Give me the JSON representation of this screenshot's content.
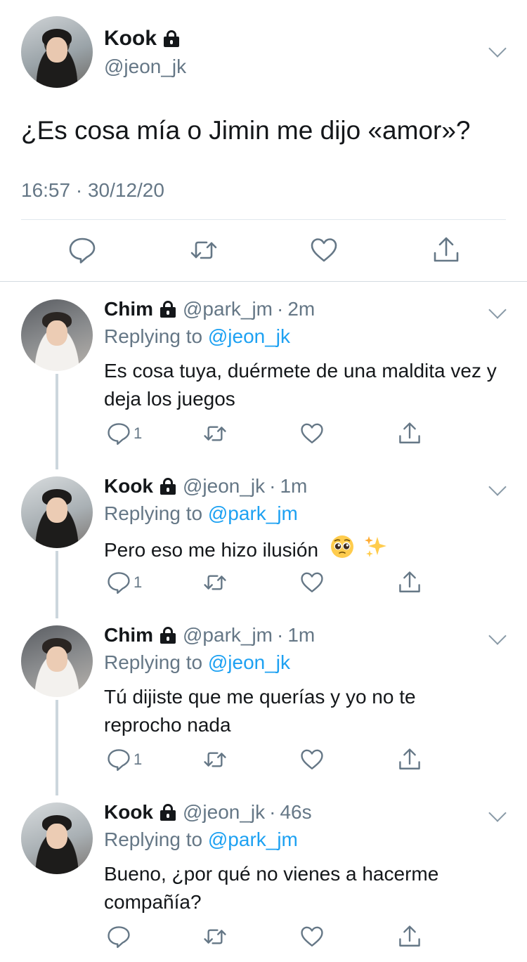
{
  "main_tweet": {
    "display_name": "Kook",
    "handle": "@jeon_jk",
    "text": "¿Es cosa mía o Jimin me dijo «amor»?",
    "timestamp": "16:57 · 30/12/20",
    "actions": [
      "reply-icon",
      "retweet-icon",
      "like-icon",
      "share-icon"
    ]
  },
  "replies": [
    {
      "display_name": "Chim",
      "handle": "@park_jm",
      "separator": "·",
      "time": "2m",
      "replying_prefix": "Replying to",
      "replying_to": "@jeon_jk",
      "text": "Es cosa tuya, duérmete de una maldita vez y deja los juegos",
      "reply_count": "1"
    },
    {
      "display_name": "Kook",
      "handle": "@jeon_jk",
      "separator": "·",
      "time": "1m",
      "replying_prefix": "Replying to",
      "replying_to": "@park_jm",
      "text": "Pero eso me hizo ilusión",
      "emojis": [
        "pleading-face-emoji",
        "sparkles-emoji"
      ],
      "reply_count": "1"
    },
    {
      "display_name": "Chim",
      "handle": "@park_jm",
      "separator": "·",
      "time": "1m",
      "replying_prefix": "Replying to",
      "replying_to": "@jeon_jk",
      "text": "Tú dijiste que me querías y yo no te reprocho nada",
      "reply_count": "1"
    },
    {
      "display_name": "Kook",
      "handle": "@jeon_jk",
      "separator": "·",
      "time": "46s",
      "replying_prefix": "Replying to",
      "replying_to": "@park_jm",
      "text": "Bueno, ¿por qué no vienes a hacerme compañía?",
      "reply_count": ""
    }
  ],
  "colors": {
    "text": "#14171a",
    "secondary": "#657786",
    "mention": "#1da1f2",
    "divider": "#e1e8ed",
    "thread_line": "#ccd6dd"
  }
}
